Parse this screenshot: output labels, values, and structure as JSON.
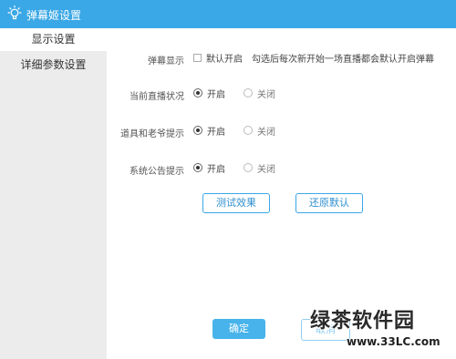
{
  "window": {
    "title": "弹幕姬设置",
    "icon": "lightbulb-icon"
  },
  "colors": {
    "accent": "#3aa7e6",
    "primary_button": "#47b3ea"
  },
  "sidebar": {
    "items": [
      {
        "label": "显示设置",
        "active": true
      },
      {
        "label": "详细参数设置",
        "active": false
      }
    ]
  },
  "settings": {
    "danmu_display": {
      "label": "弹幕显示",
      "checkbox_label": "默认开启",
      "checked": false,
      "hint": "勾选后每次新开始一场直播都会默认开启弹幕"
    },
    "live_status": {
      "label": "当前直播状况",
      "on": "开启",
      "off": "关闭",
      "selected": "on"
    },
    "gift_prompt": {
      "label": "道具和老爷提示",
      "on": "开启",
      "off": "关闭",
      "selected": "on"
    },
    "system_notice": {
      "label": "系统公告提示",
      "on": "开启",
      "off": "关闭",
      "selected": "on"
    }
  },
  "buttons": {
    "test_effect": "测试效果",
    "restore_default": "还原默认",
    "confirm": "确定",
    "cancel": "取消"
  },
  "watermark": {
    "brand": "绿茶软件园",
    "url": "www.33LC.com"
  }
}
